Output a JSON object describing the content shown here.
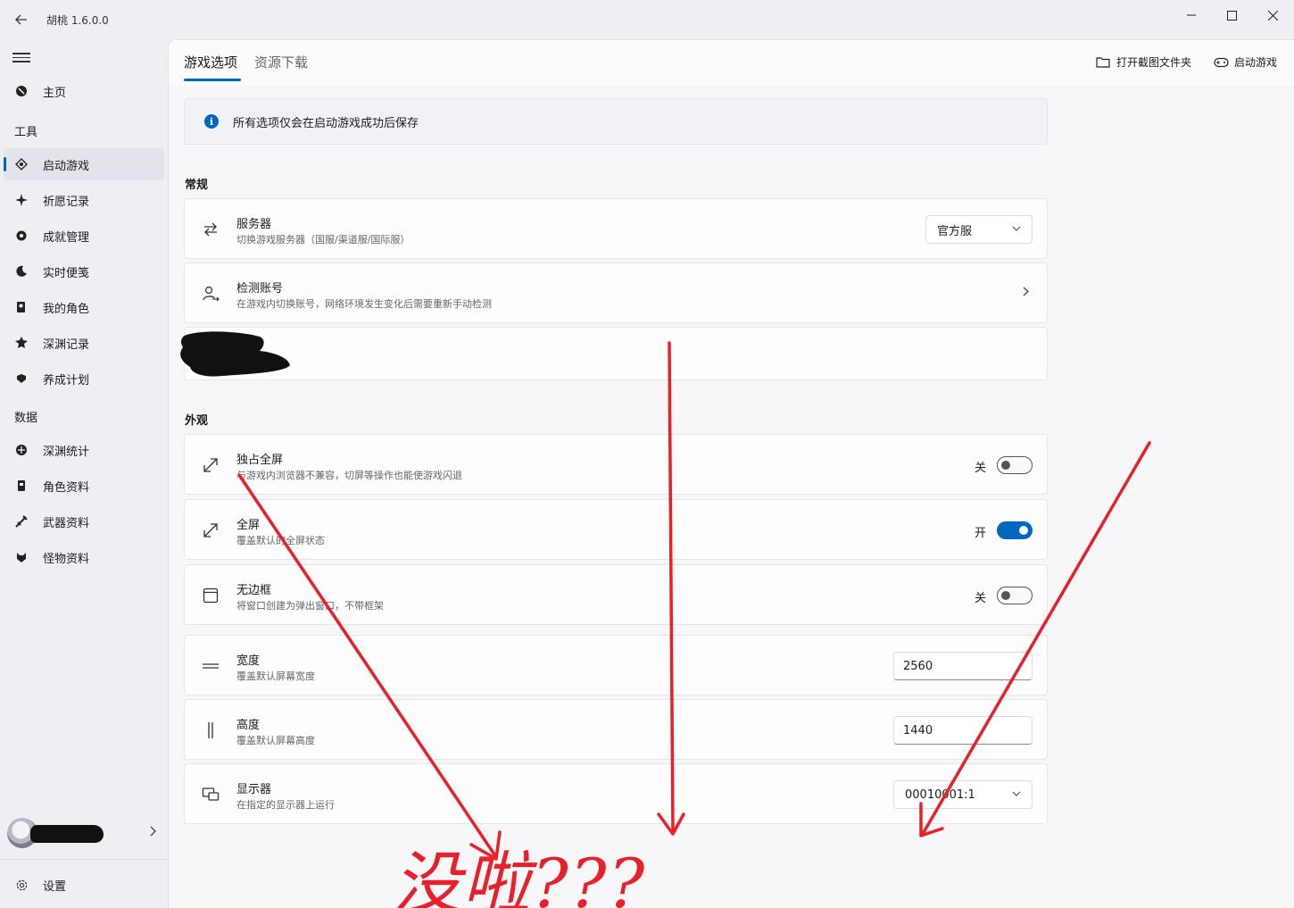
{
  "window": {
    "title": "胡桃 1.6.0.0",
    "back_icon": "back-arrow-icon",
    "controls": {
      "minimize": "—",
      "maximize": "☐",
      "close": "✕"
    }
  },
  "sidebar": {
    "menu_icon": "hamburger-icon",
    "home": {
      "label": "主页",
      "icon": "home-icon"
    },
    "tools_header": "工具",
    "tools": [
      {
        "label": "启动游戏",
        "icon": "launch-game-icon",
        "active": true
      },
      {
        "label": "祈愿记录",
        "icon": "wish-record-icon"
      },
      {
        "label": "成就管理",
        "icon": "achievement-icon"
      },
      {
        "label": "实时便笺",
        "icon": "realtime-note-icon"
      },
      {
        "label": "我的角色",
        "icon": "my-character-icon"
      },
      {
        "label": "深渊记录",
        "icon": "abyss-record-icon"
      },
      {
        "label": "养成计划",
        "icon": "cultivation-icon"
      }
    ],
    "data_header": "数据",
    "data_items": [
      {
        "label": "深渊统计",
        "icon": "abyss-stats-icon"
      },
      {
        "label": "角色资料",
        "icon": "character-wiki-icon"
      },
      {
        "label": "武器资料",
        "icon": "weapon-wiki-icon"
      },
      {
        "label": "怪物资料",
        "icon": "monster-wiki-icon"
      }
    ],
    "settings": {
      "label": "设置",
      "icon": "gear-icon"
    }
  },
  "tabs": [
    {
      "label": "游戏选项",
      "active": true
    },
    {
      "label": "资源下载",
      "active": false
    }
  ],
  "actions": {
    "open_screenshot_folder": "打开截图文件夹",
    "launch_game": "启动游戏"
  },
  "info": {
    "text": "所有选项仅会在启动游戏成功后保存"
  },
  "general": {
    "title": "常规",
    "server": {
      "title": "服务器",
      "desc": "切换游戏服务器（国服/渠道服/国际服）",
      "value": "官方服"
    },
    "detect_account": {
      "title": "检测账号",
      "desc": "在游戏内切换账号，网络环境发生变化后需要重新手动检测"
    }
  },
  "appearance": {
    "title": "外观",
    "exclusive_fullscreen": {
      "title": "独占全屏",
      "desc": "与游戏内浏览器不兼容，切屏等操作也能使游戏闪退",
      "state": "关",
      "on": false
    },
    "fullscreen": {
      "title": "全屏",
      "desc": "覆盖默认的全屏状态",
      "state": "开",
      "on": true
    },
    "borderless": {
      "title": "无边框",
      "desc": "将窗口创建为弹出窗口，不带框架",
      "state": "关",
      "on": false
    },
    "width": {
      "title": "宽度",
      "desc": "覆盖默认屏幕宽度",
      "value": "2560"
    },
    "height": {
      "title": "高度",
      "desc": "覆盖默认屏幕高度",
      "value": "1440"
    },
    "monitor": {
      "title": "显示器",
      "desc": "在指定的显示器上运行",
      "value": "00010001:1"
    }
  },
  "annotation": {
    "text": "没啦???",
    "color": "#e8202a"
  },
  "colors": {
    "accent": "#0067c0",
    "annotation": "#e8202a"
  }
}
